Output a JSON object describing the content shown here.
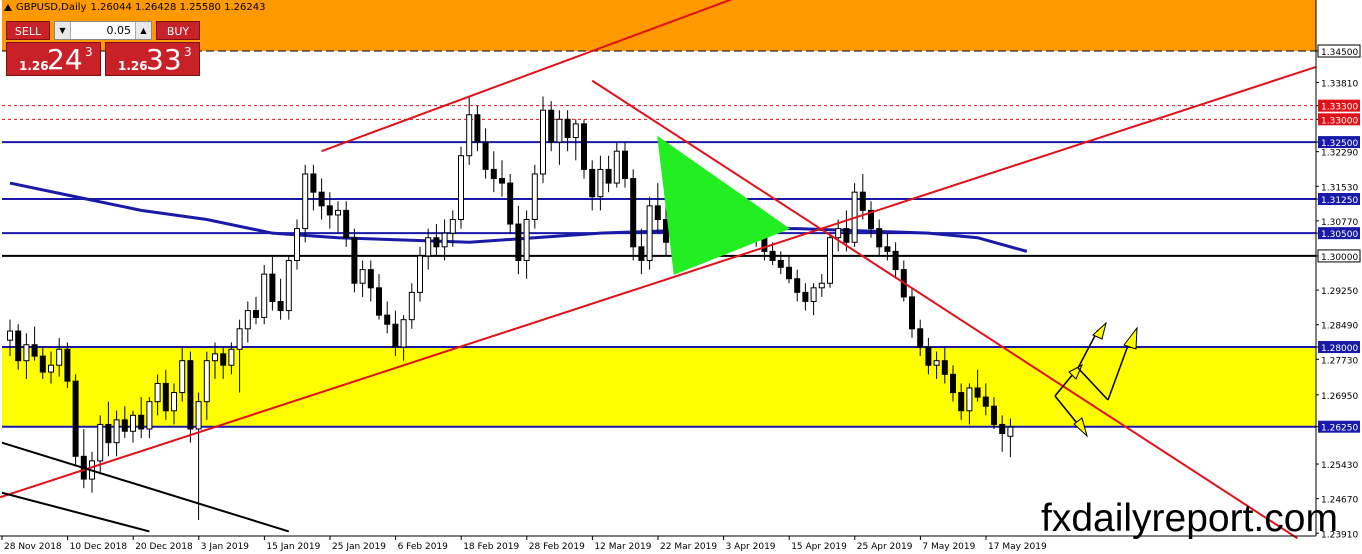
{
  "header": {
    "symbol": "GBPUSD,Daily",
    "ohlc": "1.26044 1.26428 1.25580 1.26243"
  },
  "trade_panel": {
    "sell_label": "SELL",
    "buy_label": "BUY",
    "lot": "0.05",
    "bid_prefix": "1.26",
    "bid_big": "24",
    "bid_sup": "3",
    "ask_prefix": "1.26",
    "ask_big": "33",
    "ask_sup": "3"
  },
  "watermark": "fxdailyreport.com",
  "colors": {
    "bullish_body": "#ffffff",
    "bearish_body": "#000000",
    "orange_zone": "#ff9900",
    "yellow_zone": "#ffff00",
    "moving_average": "#1a1aa8",
    "trend_red": "#e0111a",
    "blue_level": "#1a1aa8",
    "triangle_green": "#22ee22",
    "label_bg": "#1a1aa8",
    "label_red_bg": "#e0111a"
  },
  "chart_data": {
    "type": "candlestick",
    "symbol": "GBPUSD",
    "timeframe": "Daily",
    "ylim": [
      1.2385,
      1.3562
    ],
    "price_ticks": [
      "1.34500",
      "1.33810",
      "1.33300",
      "1.33000",
      "1.32500",
      "1.32290",
      "1.31530",
      "1.31250",
      "1.30770",
      "1.30500",
      "1.30000",
      "1.29250",
      "1.28490",
      "1.28000",
      "1.27730",
      "1.26950",
      "1.26250",
      "1.25430",
      "1.24670",
      "1.23910"
    ],
    "highlighted_levels": [
      {
        "price": 1.345,
        "label": "1.34500",
        "style": "dashed",
        "color": "#000000",
        "label_bg": "#ffffff"
      },
      {
        "price": 1.333,
        "label": "1.33300",
        "style": "dotted",
        "color": "#e0111a",
        "label_bg": "#e0111a"
      },
      {
        "price": 1.33,
        "label": "1.33000",
        "style": "dotted",
        "color": "#e0111a",
        "label_bg": "#e0111a"
      },
      {
        "price": 1.325,
        "label": "1.32500",
        "style": "solid",
        "color": "#1a1aa8",
        "label_bg": "#1a1aa8"
      },
      {
        "price": 1.3125,
        "label": "1.31250",
        "style": "solid",
        "color": "#1a1aa8",
        "label_bg": "#1a1aa8"
      },
      {
        "price": 1.305,
        "label": "1.30500",
        "style": "solid",
        "color": "#1a1aa8",
        "label_bg": "#1a1aa8"
      },
      {
        "price": 1.3,
        "label": "1.30000",
        "style": "solid",
        "color": "#000000",
        "label_bg": "#ffffff"
      },
      {
        "price": 1.28,
        "label": "1.28000",
        "style": "solid",
        "color": "#1a1aa8",
        "label_bg": "#1a1aa8"
      },
      {
        "price": 1.2625,
        "label": "1.26250",
        "style": "solid",
        "color": "#1a1aa8",
        "label_bg": "#1a1aa8"
      }
    ],
    "zones": [
      {
        "name": "orange-resistance-zone",
        "from": 1.345,
        "to": 1.3562,
        "color": "#ff9900"
      },
      {
        "name": "yellow-support-zone",
        "from": 1.2625,
        "to": 1.28,
        "color": "#ffff00"
      }
    ],
    "x_labels": [
      {
        "bar": 0,
        "label": "28 Nov 2018"
      },
      {
        "bar": 8,
        "label": "10 Dec 2018"
      },
      {
        "bar": 16,
        "label": "20 Dec 2018"
      },
      {
        "bar": 24,
        "label": "3 Jan 2019"
      },
      {
        "bar": 32,
        "label": "15 Jan 2019"
      },
      {
        "bar": 40,
        "label": "25 Jan 2019"
      },
      {
        "bar": 48,
        "label": "6 Feb 2019"
      },
      {
        "bar": 56,
        "label": "18 Feb 2019"
      },
      {
        "bar": 64,
        "label": "28 Feb 2019"
      },
      {
        "bar": 72,
        "label": "12 Mar 2019"
      },
      {
        "bar": 80,
        "label": "22 Mar 2019"
      },
      {
        "bar": 88,
        "label": "3 Apr 2019"
      },
      {
        "bar": 96,
        "label": "15 Apr 2019"
      },
      {
        "bar": 104,
        "label": "25 Apr 2019"
      },
      {
        "bar": 112,
        "label": "7 May 2019"
      },
      {
        "bar": 120,
        "label": "17 May 2019"
      }
    ],
    "candles": [
      [
        1.2815,
        1.286,
        1.278,
        1.2835
      ],
      [
        1.2835,
        1.285,
        1.275,
        1.277
      ],
      [
        1.277,
        1.283,
        1.273,
        1.2805
      ],
      [
        1.2805,
        1.2845,
        1.277,
        1.278
      ],
      [
        1.278,
        1.28,
        1.273,
        1.2745
      ],
      [
        1.2745,
        1.279,
        1.272,
        1.276
      ],
      [
        1.276,
        1.282,
        1.2735,
        1.2795
      ],
      [
        1.2795,
        1.281,
        1.271,
        1.2725
      ],
      [
        1.2725,
        1.274,
        1.254,
        1.256
      ],
      [
        1.256,
        1.262,
        1.249,
        1.251
      ],
      [
        1.251,
        1.257,
        1.248,
        1.255
      ],
      [
        1.255,
        1.265,
        1.252,
        1.263
      ],
      [
        1.263,
        1.268,
        1.256,
        1.259
      ],
      [
        1.259,
        1.266,
        1.256,
        1.264
      ],
      [
        1.264,
        1.267,
        1.26,
        1.2615
      ],
      [
        1.2615,
        1.266,
        1.259,
        1.265
      ],
      [
        1.265,
        1.269,
        1.26,
        1.262
      ],
      [
        1.262,
        1.269,
        1.26,
        1.268
      ],
      [
        1.268,
        1.274,
        1.265,
        1.272
      ],
      [
        1.272,
        1.275,
        1.264,
        1.266
      ],
      [
        1.266,
        1.272,
        1.263,
        1.27
      ],
      [
        1.27,
        1.28,
        1.268,
        1.277
      ],
      [
        1.277,
        1.279,
        1.259,
        1.262
      ],
      [
        1.262,
        1.27,
        1.242,
        1.268
      ],
      [
        1.268,
        1.279,
        1.264,
        1.277
      ],
      [
        1.277,
        1.281,
        1.273,
        1.2785
      ],
      [
        1.2785,
        1.28,
        1.273,
        1.276
      ],
      [
        1.276,
        1.281,
        1.274,
        1.2795
      ],
      [
        1.2795,
        1.286,
        1.27,
        1.284
      ],
      [
        1.284,
        1.29,
        1.281,
        1.288
      ],
      [
        1.288,
        1.291,
        1.285,
        1.2865
      ],
      [
        1.2865,
        1.298,
        1.285,
        1.296
      ],
      [
        1.296,
        1.3,
        1.288,
        1.29
      ],
      [
        1.29,
        1.295,
        1.286,
        1.288
      ],
      [
        1.288,
        1.3,
        1.286,
        1.299
      ],
      [
        1.299,
        1.308,
        1.297,
        1.306
      ],
      [
        1.306,
        1.32,
        1.303,
        1.318
      ],
      [
        1.318,
        1.32,
        1.31,
        1.314
      ],
      [
        1.314,
        1.317,
        1.308,
        1.311
      ],
      [
        1.311,
        1.314,
        1.306,
        1.309
      ],
      [
        1.309,
        1.312,
        1.305,
        1.31
      ],
      [
        1.31,
        1.312,
        1.302,
        1.304
      ],
      [
        1.304,
        1.306,
        1.292,
        1.294
      ],
      [
        1.294,
        1.299,
        1.291,
        1.297
      ],
      [
        1.297,
        1.299,
        1.29,
        1.293
      ],
      [
        1.293,
        1.296,
        1.286,
        1.287
      ],
      [
        1.287,
        1.29,
        1.283,
        1.285
      ],
      [
        1.285,
        1.288,
        1.278,
        1.28
      ],
      [
        1.28,
        1.287,
        1.277,
        1.286
      ],
      [
        1.286,
        1.294,
        1.284,
        1.292
      ],
      [
        1.292,
        1.302,
        1.29,
        1.3
      ],
      [
        1.3,
        1.306,
        1.297,
        1.304
      ],
      [
        1.304,
        1.307,
        1.3,
        1.302
      ],
      [
        1.302,
        1.308,
        1.299,
        1.305
      ],
      [
        1.305,
        1.31,
        1.302,
        1.308
      ],
      [
        1.308,
        1.324,
        1.306,
        1.322
      ],
      [
        1.322,
        1.335,
        1.32,
        1.331
      ],
      [
        1.331,
        1.333,
        1.323,
        1.325
      ],
      [
        1.325,
        1.328,
        1.317,
        1.319
      ],
      [
        1.319,
        1.323,
        1.314,
        1.317
      ],
      [
        1.317,
        1.321,
        1.313,
        1.316
      ],
      [
        1.316,
        1.318,
        1.305,
        1.307
      ],
      [
        1.307,
        1.311,
        1.296,
        1.299
      ],
      [
        1.299,
        1.31,
        1.295,
        1.308
      ],
      [
        1.308,
        1.32,
        1.306,
        1.318
      ],
      [
        1.318,
        1.335,
        1.316,
        1.332
      ],
      [
        1.332,
        1.334,
        1.323,
        1.325
      ],
      [
        1.325,
        1.332,
        1.32,
        1.33
      ],
      [
        1.33,
        1.332,
        1.323,
        1.326
      ],
      [
        1.326,
        1.33,
        1.321,
        1.329
      ],
      [
        1.329,
        1.33,
        1.317,
        1.319
      ],
      [
        1.319,
        1.321,
        1.31,
        1.313
      ],
      [
        1.313,
        1.322,
        1.31,
        1.319
      ],
      [
        1.319,
        1.322,
        1.314,
        1.316
      ],
      [
        1.316,
        1.325,
        1.315,
        1.323
      ],
      [
        1.323,
        1.325,
        1.315,
        1.317
      ],
      [
        1.317,
        1.319,
        1.299,
        1.302
      ],
      [
        1.302,
        1.306,
        1.296,
        1.299
      ],
      [
        1.299,
        1.313,
        1.297,
        1.311
      ],
      [
        1.311,
        1.316,
        1.305,
        1.308
      ],
      [
        1.308,
        1.312,
        1.3,
        1.303
      ],
      [
        1.303,
        1.309,
        1.301,
        1.307
      ],
      [
        1.307,
        1.315,
        1.304,
        1.312
      ],
      [
        1.312,
        1.318,
        1.306,
        1.308
      ],
      [
        1.308,
        1.311,
        1.303,
        1.305
      ],
      [
        1.305,
        1.308,
        1.302,
        1.306
      ],
      [
        1.306,
        1.31,
        1.302,
        1.304
      ],
      [
        1.304,
        1.308,
        1.301,
        1.3065
      ],
      [
        1.3065,
        1.311,
        1.304,
        1.306
      ],
      [
        1.306,
        1.31,
        1.304,
        1.308
      ],
      [
        1.308,
        1.312,
        1.305,
        1.306
      ],
      [
        1.306,
        1.308,
        1.302,
        1.304
      ],
      [
        1.304,
        1.305,
        1.299,
        1.301
      ],
      [
        1.301,
        1.303,
        1.298,
        1.299
      ],
      [
        1.299,
        1.301,
        1.296,
        1.2975
      ],
      [
        1.2975,
        1.3,
        1.294,
        1.295
      ],
      [
        1.295,
        1.297,
        1.29,
        1.292
      ],
      [
        1.292,
        1.294,
        1.288,
        1.29
      ],
      [
        1.29,
        1.294,
        1.287,
        1.293
      ],
      [
        1.293,
        1.296,
        1.291,
        1.294
      ],
      [
        1.294,
        1.305,
        1.293,
        1.304
      ],
      [
        1.304,
        1.308,
        1.301,
        1.306
      ],
      [
        1.306,
        1.31,
        1.301,
        1.303
      ],
      [
        1.303,
        1.316,
        1.302,
        1.314
      ],
      [
        1.314,
        1.318,
        1.308,
        1.31
      ],
      [
        1.31,
        1.312,
        1.304,
        1.306
      ],
      [
        1.306,
        1.308,
        1.3,
        1.302
      ],
      [
        1.302,
        1.305,
        1.299,
        1.301
      ],
      [
        1.301,
        1.303,
        1.295,
        1.297
      ],
      [
        1.297,
        1.299,
        1.29,
        1.291
      ],
      [
        1.291,
        1.293,
        1.282,
        1.284
      ],
      [
        1.284,
        1.286,
        1.278,
        1.28
      ],
      [
        1.28,
        1.282,
        1.274,
        1.276
      ],
      [
        1.276,
        1.279,
        1.273,
        1.277
      ],
      [
        1.277,
        1.28,
        1.272,
        1.274
      ],
      [
        1.274,
        1.276,
        1.268,
        1.27
      ],
      [
        1.27,
        1.272,
        1.264,
        1.266
      ],
      [
        1.266,
        1.272,
        1.263,
        1.271
      ],
      [
        1.271,
        1.275,
        1.268,
        1.269
      ],
      [
        1.269,
        1.272,
        1.265,
        1.267
      ],
      [
        1.267,
        1.269,
        1.262,
        1.263
      ],
      [
        1.263,
        1.265,
        1.257,
        1.261
      ],
      [
        1.2604,
        1.2643,
        1.2558,
        1.2624
      ]
    ],
    "moving_average": [
      [
        0,
        1.316
      ],
      [
        8,
        1.313
      ],
      [
        16,
        1.31
      ],
      [
        24,
        1.308
      ],
      [
        32,
        1.305
      ],
      [
        40,
        1.304
      ],
      [
        48,
        1.3035
      ],
      [
        56,
        1.303
      ],
      [
        64,
        1.304
      ],
      [
        72,
        1.305
      ],
      [
        80,
        1.3055
      ],
      [
        88,
        1.306
      ],
      [
        96,
        1.306
      ],
      [
        104,
        1.3055
      ],
      [
        112,
        1.305
      ],
      [
        118,
        1.304
      ],
      [
        124,
        1.301
      ]
    ]
  }
}
